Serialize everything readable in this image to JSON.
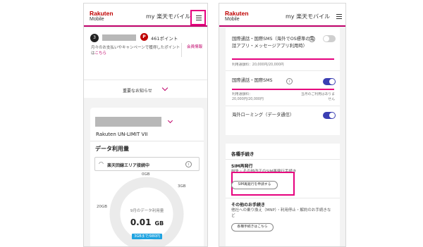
{
  "left": {
    "header": {
      "logo_line1": "Rakuten",
      "logo_line2": "Mobile",
      "title": "my 楽天モバイル"
    },
    "points": {
      "medal": "3",
      "badge": "P",
      "value": "461ポイント",
      "note": "月々のお支払いやキャンペーンで獲得したポイントは",
      "note_link": "こちら",
      "member": "会員情報"
    },
    "notice": {
      "label": "重要なお知らせ"
    },
    "plan": {
      "name": "Rakuten UN-LIMIT VII"
    },
    "data_usage": {
      "title": "データ利用量",
      "area_status": "楽天回線エリア接続中",
      "ticks": [
        "0GB",
        "3GB",
        "20GB"
      ],
      "month_label": "9月のデータ利用量",
      "value": "0.01",
      "unit": "GB",
      "tier": "3GBまで/980円"
    },
    "colors": {
      "accent": "#bf0069",
      "brand": "#bf0000",
      "tier_badge": "#1fa3e0"
    }
  },
  "right": {
    "header": {
      "logo_line1": "Rakuten",
      "logo_line2": "Mobile",
      "title": "my 楽天モバイル"
    },
    "rows": {
      "intl_calls": {
        "label": "国際通話・国際SMS（海外でOS標準の電話アプリ・メッセージアプリ利用時）",
        "limit": "利用通額料：20,000円/20,000円",
        "enabled": false
      },
      "intl_sms": {
        "label": "国際通話・国際SMS",
        "limit_label": "利用通額料：",
        "limit_value": "20,000円/20,000円",
        "side_note": "当月のご利用はありません",
        "enabled": true
      },
      "roaming": {
        "label": "海外ローミング（データ通信）",
        "enabled": true
      }
    },
    "procedures": {
      "title": "各種手続き",
      "sim": {
        "title": "SIM再発行",
        "desc": "紛失・その他改正のSIM再発行手続き",
        "button": "SIM再発行を申請する"
      },
      "other": {
        "title": "その他のお手続き",
        "desc": "他社への乗り換え（MNP）・利用停止・解約のお手続きなど",
        "button": "各種手続きはこちら"
      }
    }
  }
}
